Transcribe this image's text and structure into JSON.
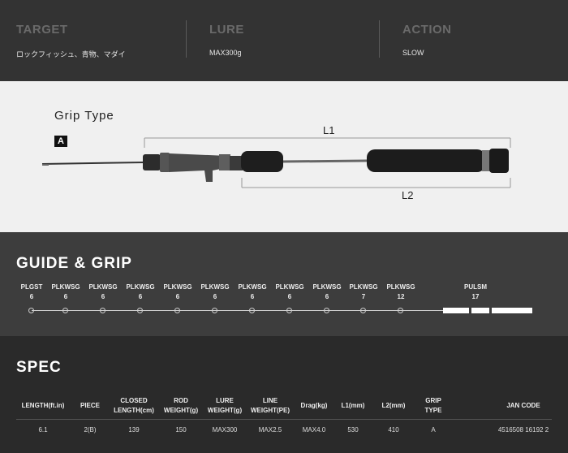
{
  "top": {
    "columns": [
      {
        "heading": "TARGET",
        "value": "ロックフィッシュ、青物、マダイ"
      },
      {
        "heading": "LURE",
        "value": "MAX300g"
      },
      {
        "heading": "ACTION",
        "value": "SLOW"
      }
    ]
  },
  "grip": {
    "title": "Grip Type",
    "type": "A",
    "l1": "L1",
    "l2": "L2"
  },
  "guide": {
    "title": "GUIDE & GRIP",
    "items": [
      {
        "name": "PLGST",
        "size": "6"
      },
      {
        "name": "PLKWSG",
        "size": "6"
      },
      {
        "name": "PLKWSG",
        "size": "6"
      },
      {
        "name": "PLKWSG",
        "size": "6"
      },
      {
        "name": "PLKWSG",
        "size": "6"
      },
      {
        "name": "PLKWSG",
        "size": "6"
      },
      {
        "name": "PLKWSG",
        "size": "6"
      },
      {
        "name": "PLKWSG",
        "size": "6"
      },
      {
        "name": "PLKWSG",
        "size": "6"
      },
      {
        "name": "PLKWSG",
        "size": "7"
      },
      {
        "name": "PLKWSG",
        "size": "12"
      },
      {
        "name": "PULSM",
        "size": "17"
      }
    ]
  },
  "spec": {
    "title": "SPEC",
    "headers": [
      [
        "LENGTH(ft.in)"
      ],
      [
        "PIECE"
      ],
      [
        "CLOSED",
        "LENGTH(cm)"
      ],
      [
        "ROD",
        "WEIGHT(g)"
      ],
      [
        "LURE",
        "WEIGHT(g)"
      ],
      [
        "LINE",
        "WEIGHT(PE)"
      ],
      [
        "Drag(kg)"
      ],
      [
        "L1(mm)"
      ],
      [
        "L2(mm)"
      ],
      [
        "GRIP",
        "TYPE"
      ],
      [
        "JAN CODE"
      ]
    ],
    "values": [
      "6.1",
      "2(B)",
      "139",
      "150",
      "MAX300",
      "MAX2.5",
      "MAX4.0",
      "530",
      "410",
      "A",
      "4516508 16192 2"
    ]
  },
  "colors": {
    "top_bg": "#333333",
    "grip_bg": "#f0f0f0",
    "guide_bg": "#3d3d3d",
    "spec_bg": "#2a2a2a"
  }
}
